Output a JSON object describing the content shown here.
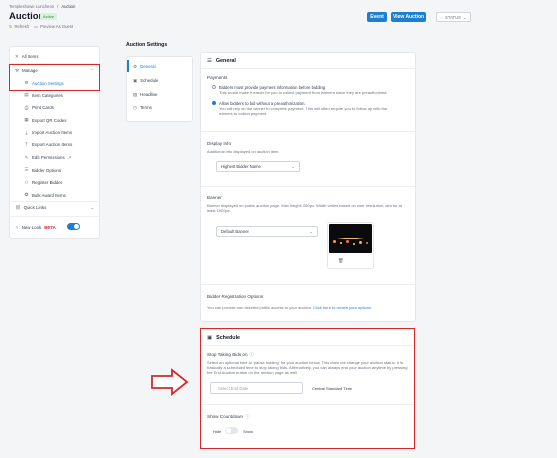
{
  "breadcrumb": {
    "parent": "Templeshowe Luncheon",
    "sep": "/",
    "current": "Auction"
  },
  "header": {
    "title": "Auction",
    "badge": "Active",
    "refresh": "Refresh",
    "preview": "Preview As Guest",
    "event_button": "Event",
    "view_auction_button": "View Auction",
    "status_button": "STATUS"
  },
  "sidebar": {
    "all_items": "All Items",
    "manage": "Manage",
    "items": [
      {
        "label": "Auction Settings",
        "icon": "gear-icon"
      },
      {
        "label": "Item Categories",
        "icon": "tag-icon"
      },
      {
        "label": "Print Cards",
        "icon": "print-icon"
      },
      {
        "label": "Export QR Codes",
        "icon": "qr-icon"
      },
      {
        "label": "Import Auction Items",
        "icon": "download-icon"
      },
      {
        "label": "Export Auction Items",
        "icon": "upload-icon"
      },
      {
        "label": "Edit Permissions",
        "icon": "pencil-icon"
      },
      {
        "label": "Bidder Options",
        "icon": "list-icon"
      },
      {
        "label": "Register Bidder",
        "icon": "user-plus-icon"
      },
      {
        "label": "Bulk Award Items",
        "icon": "award-icon"
      }
    ],
    "quick_links": "Quick Links",
    "new_look": "New Look",
    "beta": "BETA"
  },
  "settings_nav": {
    "title": "Auction Settings",
    "items": [
      "General",
      "Schedule",
      "Headline",
      "Terms"
    ]
  },
  "general": {
    "title": "General",
    "payments": {
      "label": "Payments",
      "option1_title": "Bidders must provide payment information before bidding",
      "option1_desc": "This would make it easier for you to collect payment from winners since they are preauthorized.",
      "option2_title": "Allow bidders to bid without a preauthorization.",
      "option2_desc": "You will rely on the winner to complete payment. This will often require you to follow up with the winners to collect payment."
    },
    "display_info": {
      "label": "Display Info",
      "desc": "Additional info displayed on auction item.",
      "value": "Highest Bidder Name"
    },
    "banner": {
      "label": "Banner",
      "desc": "Banner displayed on public auction page. Max height: 250px. Width varies based on user resolution, aim for at least 1920px.",
      "value": "Default Banner"
    },
    "bidder_registration": {
      "label": "Bidder Registration Options",
      "desc": "You can provide non-ticketed public access to your auction.",
      "link": "Click here to review your options."
    }
  },
  "schedule": {
    "title": "Schedule",
    "stop_label": "Stop Taking Bids on",
    "stop_desc": "Select an optional time to 'pause bidding' for your auction below. This does not change your auction status. It is basically a scheduled time to stop taking bids. Alternatively, you can always end your auction anytime by pressing the End Auction button on the auction page as well.",
    "date_placeholder": "Select End Date",
    "timezone": "Central Standard Time",
    "countdown_label": "Show Countdown",
    "hide": "Hide",
    "show": "Show"
  },
  "colors": {
    "accent": "#1d7fd1",
    "highlight": "#d62828",
    "badge_bg": "#d9f2dc",
    "badge_fg": "#2e8b43"
  }
}
